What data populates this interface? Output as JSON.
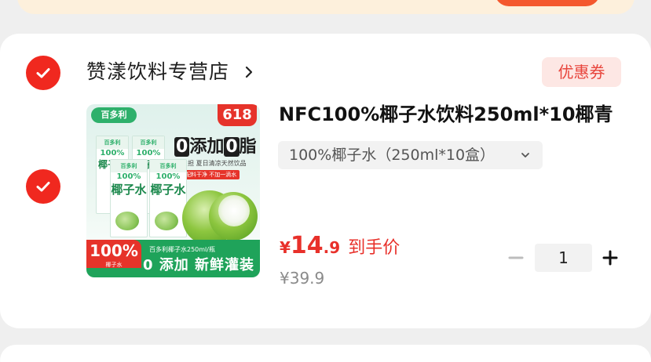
{
  "store": {
    "name": "赞漾饮料专营店",
    "chevron": "›",
    "coupon_label": "优惠券"
  },
  "product": {
    "title": "NFC100%椰子水饮料250ml*10椰青",
    "variant": "100%椰子水（250ml*10盒）",
    "image": {
      "logo": "百多利",
      "badge_618": "618",
      "headline_a": "0",
      "headline_b": "添加",
      "headline_c": "0",
      "headline_d": "脂",
      "sub": "0负担 夏日清凉天然饮品",
      "tag": "配料干净 不加一滴水",
      "box_top": "百多利",
      "box_pct": "100%",
      "box_name": "椰子水",
      "badge_100": "100%",
      "badge_100_sub": "椰子水",
      "spec": "百多利椰子水250ml/瓶",
      "bottom_text": "0 添加 新鲜灌装"
    },
    "price": {
      "currency": "¥",
      "integer": "14",
      "decimal": ".9",
      "label": "到手价"
    },
    "original_price": "¥39.9",
    "quantity": "1"
  },
  "colors": {
    "accent_red": "#f0281f",
    "price_red": "#e8302a",
    "coupon_bg": "#fde7e4",
    "coupon_text": "#e8453c"
  },
  "icons": {
    "check": "check-icon",
    "chevron_right": "chevron-right-icon",
    "chevron_down": "chevron-down-icon",
    "minus": "minus-icon",
    "plus": "plus-icon"
  }
}
